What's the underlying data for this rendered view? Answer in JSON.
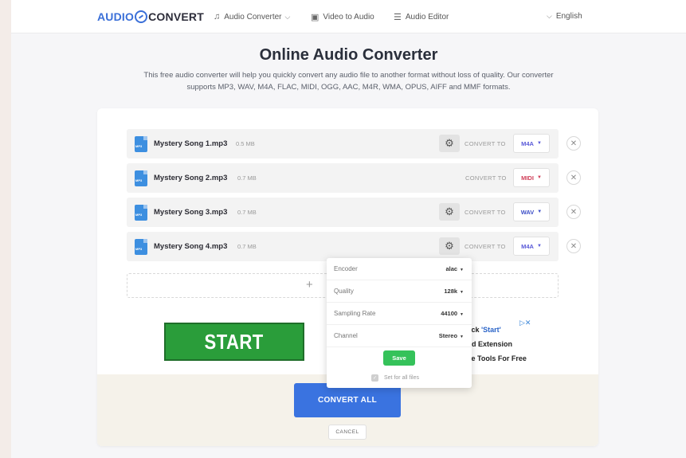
{
  "header": {
    "logo_left": "AUDIO",
    "logo_right": "CONVERT",
    "nav": [
      {
        "label": "Audio Converter",
        "icon": "music-note-icon",
        "has_dropdown": true
      },
      {
        "label": "Video to Audio",
        "icon": "play-icon",
        "has_dropdown": false
      },
      {
        "label": "Audio Editor",
        "icon": "sliders-icon",
        "has_dropdown": false
      }
    ],
    "language": "English"
  },
  "hero": {
    "title": "Online Audio Converter",
    "subtitle_line1": "This free audio converter will help you quickly convert any audio file to another format without loss of quality. Our converter",
    "subtitle_line2": "supports MP3, WAV, M4A, FLAC, MIDI, OGG, AAC, M4R, WMA, OPUS, AIFF and MMF formats."
  },
  "files": [
    {
      "name": "Mystery Song 1.mp3",
      "size": "0.5 MB",
      "convert_to_label": "CONVERT TO",
      "format": "M4A",
      "format_color": "#5a5ad8"
    },
    {
      "name": "Mystery Song 2.mp3",
      "size": "0.7 MB",
      "convert_to_label": "CONVERT TO",
      "format": "MIDI",
      "format_color": "#d0405a"
    },
    {
      "name": "Mystery Song 3.mp3",
      "size": "0.7 MB",
      "convert_to_label": "CONVERT TO",
      "format": "WAV",
      "format_color": "#3d4fc8"
    },
    {
      "name": "Mystery Song 4.mp3",
      "size": "0.7 MB",
      "convert_to_label": "CONVERT TO",
      "format": "M4A",
      "format_color": "#5a5ad8"
    }
  ],
  "settings_popup": {
    "rows": [
      {
        "label": "Encoder",
        "value": "alac"
      },
      {
        "label": "Quality",
        "value": "128k"
      },
      {
        "label": "Sampling Rate",
        "value": "44100"
      },
      {
        "label": "Channel",
        "value": "Stereo"
      }
    ],
    "save_label": "Save",
    "set_all_label": "Set for all files"
  },
  "ad": {
    "button_label": "START",
    "line1_prefix": "Click ",
    "line1_quote": "'Start'",
    "line2": "Add Extension",
    "line3": "Use Tools For Free"
  },
  "actions": {
    "convert_all": "CONVERT ALL",
    "cancel": "CANCEL"
  }
}
